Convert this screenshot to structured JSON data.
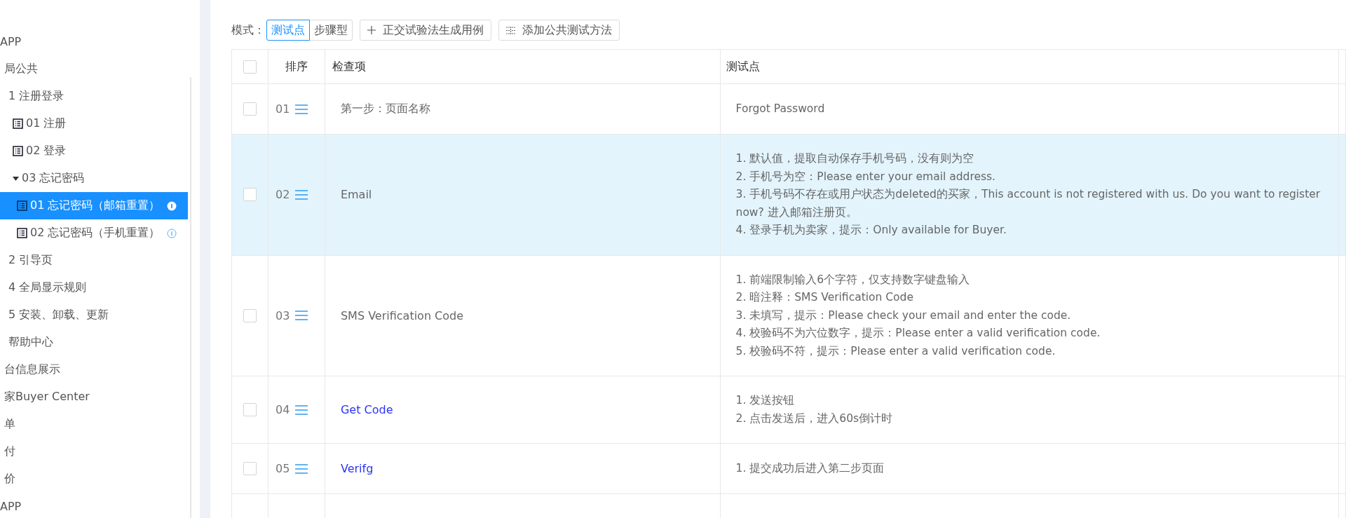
{
  "sidebar": {
    "tree": [
      {
        "label": "APP",
        "selected": false,
        "children": [
          {
            "label": "局公共",
            "selected": false,
            "children": [
              {
                "label": "1 注册登录",
                "selected": false,
                "children": [
                  {
                    "label": "01 注册",
                    "kind": "case",
                    "selected": false
                  },
                  {
                    "label": "02 登录",
                    "kind": "case",
                    "selected": false
                  },
                  {
                    "label": "03 忘记密码",
                    "kind": "folder",
                    "selected": false,
                    "children": [
                      {
                        "label": "01 忘记密码（邮箱重置）",
                        "kind": "case",
                        "selected": true,
                        "info": true
                      },
                      {
                        "label": "02 忘记密码（手机重置）",
                        "kind": "case",
                        "selected": false,
                        "info": true
                      }
                    ]
                  }
                ]
              },
              {
                "label": "2 引导页",
                "selected": false
              },
              {
                "label": "4 全局显示规则",
                "selected": false
              },
              {
                "label": "5 安装、卸载、更新",
                "selected": false
              },
              {
                "label": "帮助中心",
                "selected": false
              }
            ]
          },
          {
            "label": "台信息展示",
            "selected": false
          },
          {
            "label": "家Buyer Center",
            "selected": false
          },
          {
            "label": "单",
            "selected": false
          },
          {
            "label": "付",
            "selected": false
          },
          {
            "label": "价",
            "selected": false
          }
        ]
      },
      {
        "label": "APP",
        "selected": false
      }
    ]
  },
  "toolbar": {
    "mode_label": "模式：",
    "modes": [
      {
        "label": "测试点",
        "selected": true
      },
      {
        "label": "步骤型",
        "selected": false
      }
    ],
    "buttons": [
      {
        "label": "正交试验法生成用例",
        "kind": "plus"
      },
      {
        "label": "添加公共测试方法",
        "kind": "grid"
      }
    ]
  },
  "table": {
    "columns": [
      "排序",
      "检查项",
      "测试点"
    ],
    "header_checked": false,
    "rows": [
      {
        "index": "01",
        "item": "第一步：页面名称",
        "linked": false,
        "checked": false,
        "selected": false,
        "points": [
          "Forgot Password"
        ]
      },
      {
        "index": "02",
        "item": "Email",
        "linked": false,
        "checked": false,
        "selected": true,
        "points": [
          "1. 默认值，提取自动保存手机号码，没有则为空",
          "2. 手机号为空：Please enter your email address.",
          "3. 手机号码不存在或用户状态为deleted的买家，This account is not registered with us. Do you want to register now? 进入邮箱注册页。",
          "4. 登录手机为卖家，提示：Only available for Buyer."
        ]
      },
      {
        "index": "03",
        "item": "SMS Verification Code",
        "linked": false,
        "checked": false,
        "selected": false,
        "points": [
          "1. 前端限制输入6个字符，仅支持数字键盘输入",
          "2. 暗注释：SMS Verification Code",
          "3. 未填写，提示：Please check your email and enter the code.",
          "4. 校验码不为六位数字，提示：Please enter a valid verification code.",
          "5. 校验码不符，提示：Please enter a valid verification code."
        ]
      },
      {
        "index": "04",
        "item": "Get Code",
        "linked": true,
        "checked": false,
        "selected": false,
        "points": [
          "1. 发送按钮",
          "2. 点击发送后，进入60s倒计时"
        ]
      },
      {
        "index": "05",
        "item": "Verifg",
        "linked": true,
        "checked": false,
        "selected": false,
        "points": [
          "1. 提交成功后进入第二步页面"
        ]
      }
    ]
  }
}
